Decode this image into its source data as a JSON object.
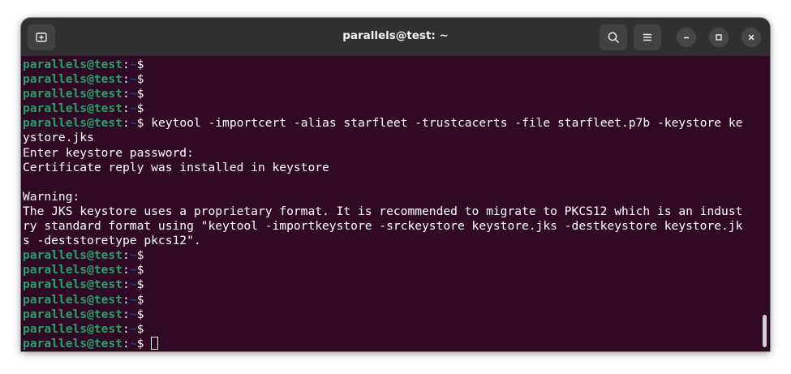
{
  "window": {
    "title": "parallels@test: ~"
  },
  "titlebar": {
    "new_tab_icon": "new-tab-icon",
    "search_icon": "search-icon",
    "menu_icon": "hamburger-menu-icon",
    "minimize_icon": "minimize-icon",
    "maximize_icon": "maximize-icon",
    "close_icon": "close-icon"
  },
  "prompt": {
    "user_host": "parallels@test",
    "separator": ":",
    "path": "~",
    "symbol": "$ "
  },
  "terminal": {
    "lines": [
      {
        "prompt": true,
        "command": ""
      },
      {
        "prompt": true,
        "command": ""
      },
      {
        "prompt": true,
        "command": ""
      },
      {
        "prompt": true,
        "command": ""
      },
      {
        "prompt": true,
        "command": "keytool -importcert -alias starfleet -trustcacerts -file starfleet.p7b -keystore ke"
      },
      {
        "prompt": false,
        "text": "ystore.jks"
      },
      {
        "prompt": false,
        "text": "Enter keystore password:"
      },
      {
        "prompt": false,
        "text": "Certificate reply was installed in keystore"
      },
      {
        "prompt": false,
        "text": ""
      },
      {
        "prompt": false,
        "text": "Warning:"
      },
      {
        "prompt": false,
        "text": "The JKS keystore uses a proprietary format. It is recommended to migrate to PKCS12 which is an indust"
      },
      {
        "prompt": false,
        "text": "ry standard format using \"keytool -importkeystore -srckeystore keystore.jks -destkeystore keystore.jk"
      },
      {
        "prompt": false,
        "text": "s -deststoretype pkcs12\"."
      },
      {
        "prompt": true,
        "command": ""
      },
      {
        "prompt": true,
        "command": ""
      },
      {
        "prompt": true,
        "command": ""
      },
      {
        "prompt": true,
        "command": ""
      },
      {
        "prompt": true,
        "command": ""
      },
      {
        "prompt": true,
        "command": ""
      },
      {
        "prompt": true,
        "command": "",
        "cursor": true
      }
    ]
  },
  "colors": {
    "background": "#300a24",
    "titlebar": "#303030",
    "prompt_user": "#26a269",
    "prompt_path": "#12488b",
    "text": "#ffffff"
  }
}
